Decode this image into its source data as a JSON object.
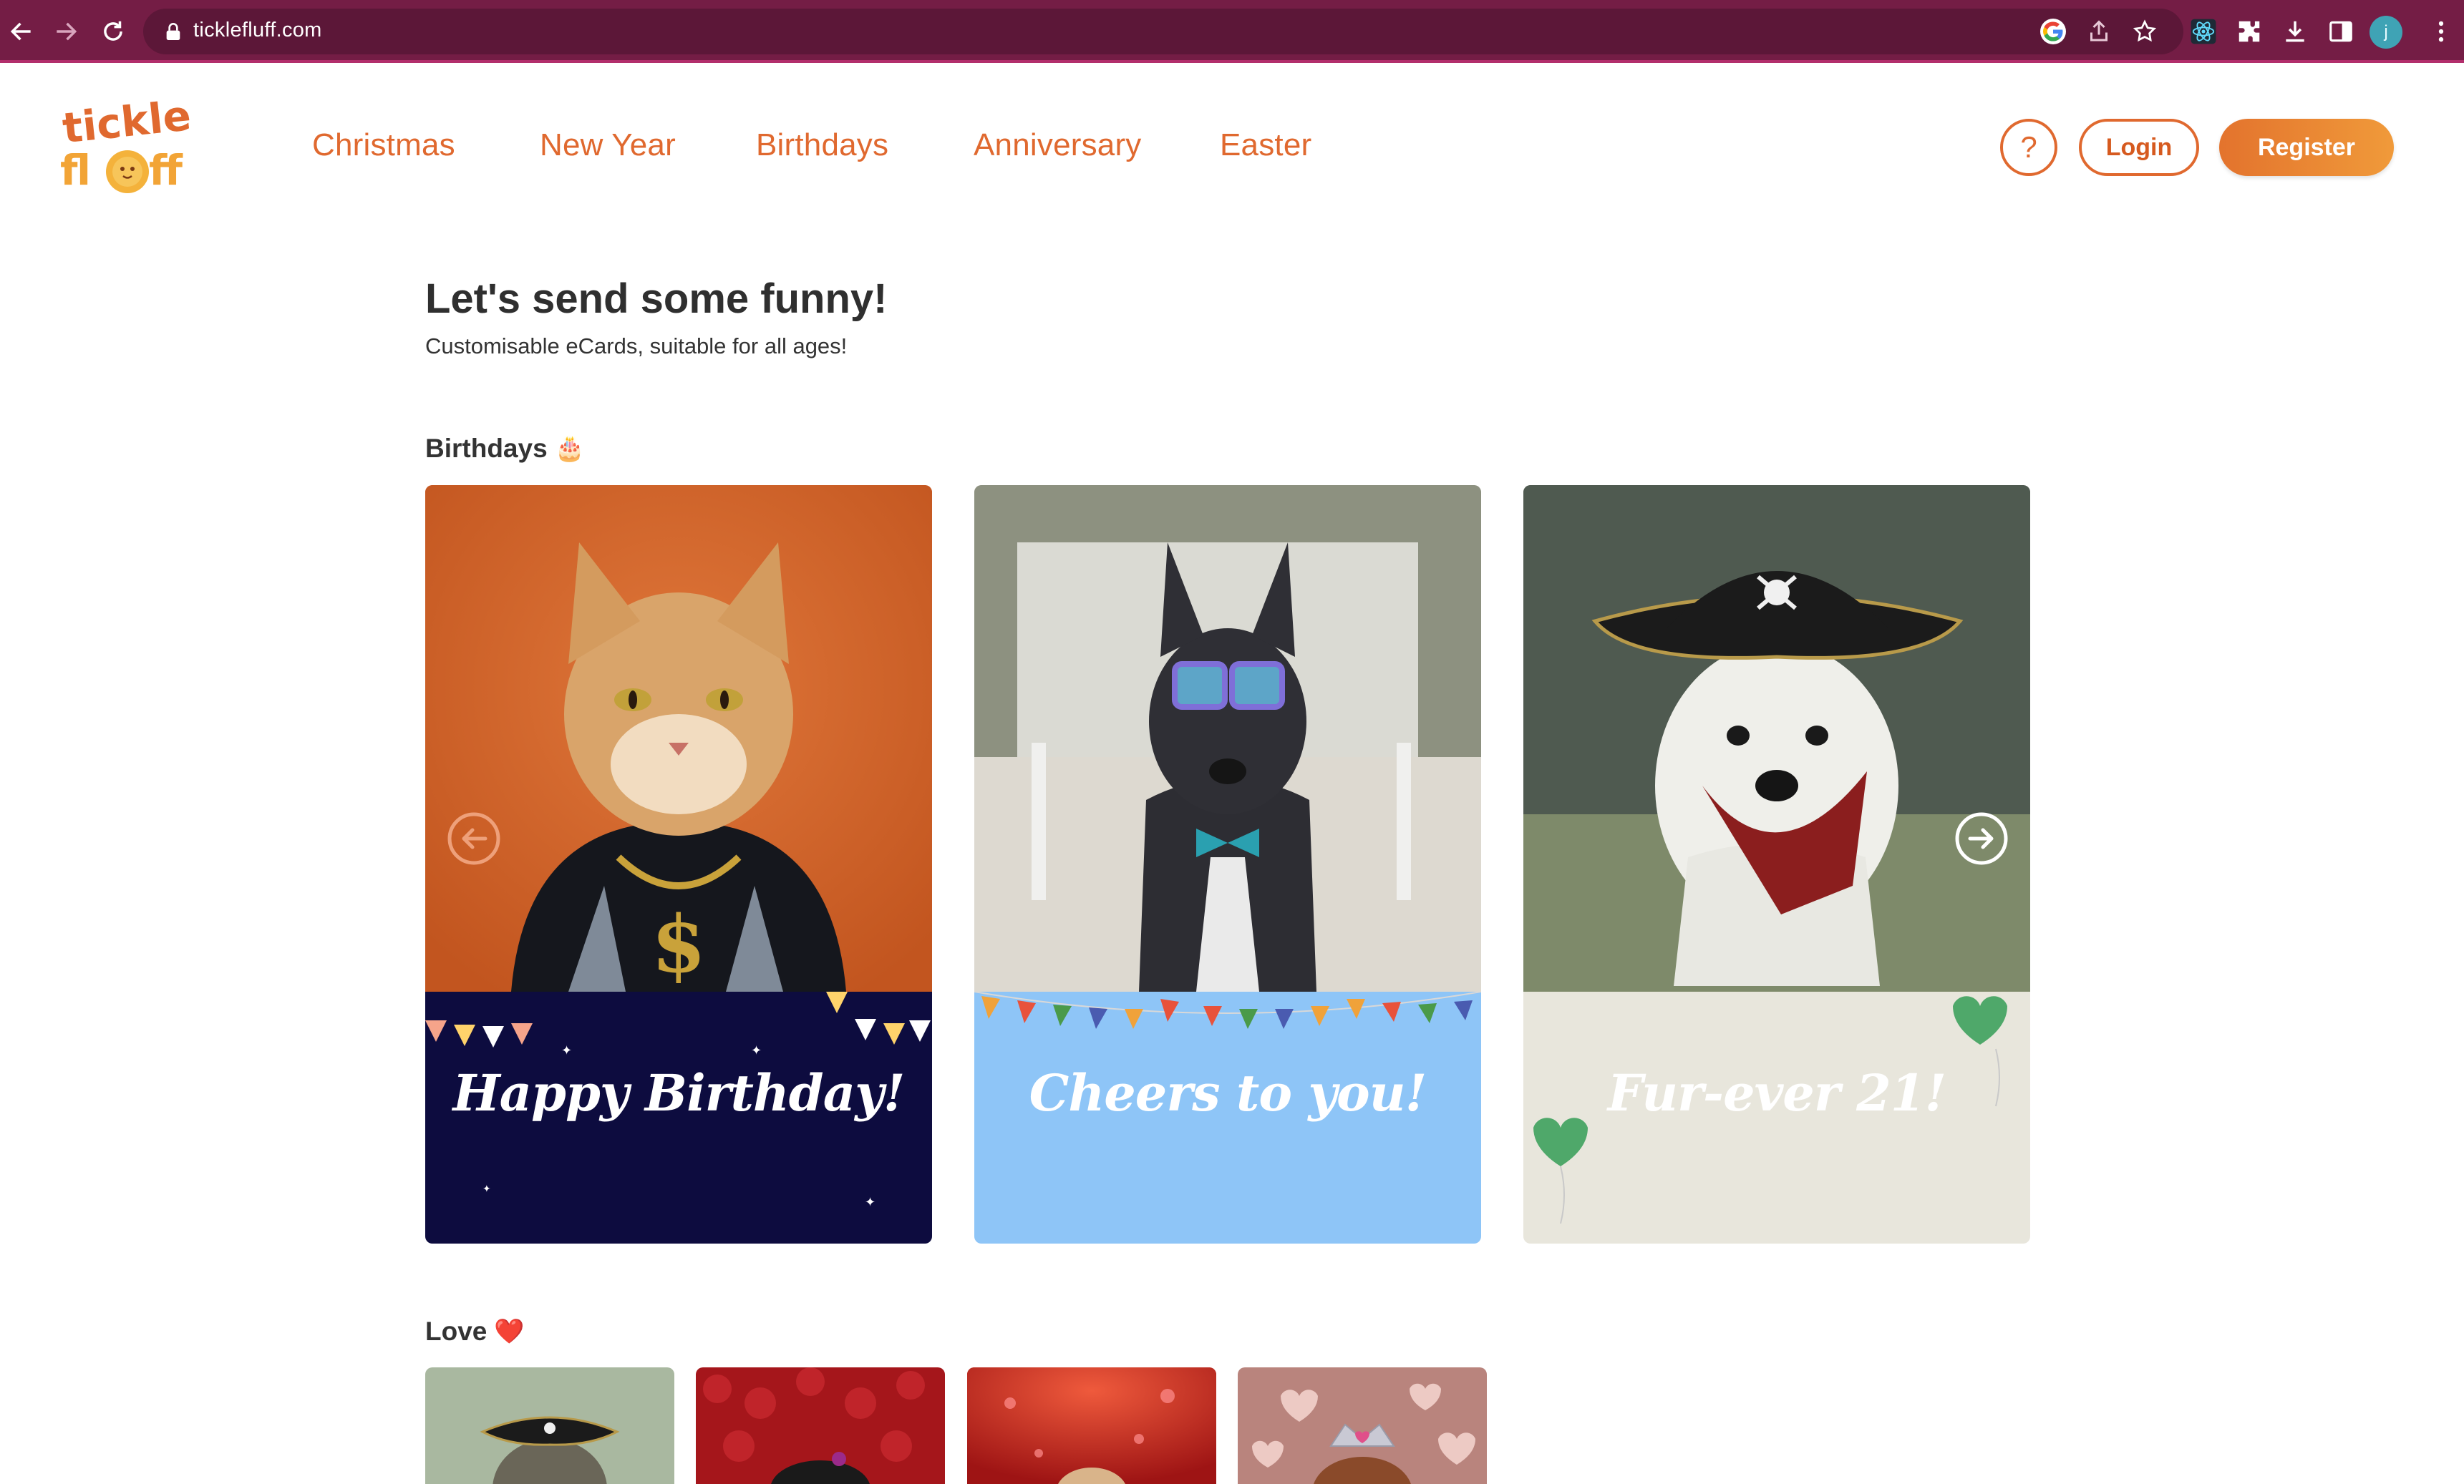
{
  "browser": {
    "url": "ticklefluff.com",
    "profile_initial": "j",
    "icons": [
      "back-arrow-icon",
      "forward-arrow-icon",
      "reload-icon",
      "lock-icon",
      "google-icon",
      "share-icon",
      "star-icon",
      "react-devtools-icon",
      "extensions-icon",
      "download-icon",
      "sidepanel-icon"
    ]
  },
  "header": {
    "logo_line1": "tickle",
    "logo_line2": "fluff",
    "nav": [
      "Christmas",
      "New Year",
      "Birthdays",
      "Anniversary",
      "Easter"
    ],
    "help_label": "?",
    "login_label": "Login",
    "register_label": "Register"
  },
  "hero": {
    "title": "Let's send some funny!",
    "subtitle": "Customisable eCards, suitable for all ages!"
  },
  "sections": {
    "birthdays": {
      "title": "Birthdays",
      "emoji": "🎂",
      "cards": [
        {
          "caption": "Happy Birthday!",
          "photo": "cat with gold chain",
          "banner_color": "#0d0c3f"
        },
        {
          "caption": "Cheers to you!",
          "photo": "dog with sunglasses and bow tie",
          "banner_color": "#8ec5f7"
        },
        {
          "caption": "Fur-ever 21!",
          "photo": "dog in pirate hat",
          "banner_color": "#e8e6dc"
        }
      ],
      "prev_arrow": "arrow-left-icon",
      "next_arrow": "arrow-right-icon"
    },
    "love": {
      "title": "Love",
      "emoji": "❤️",
      "thumbs": [
        "pirate cat",
        "dog on roses",
        "dog with hearts",
        "dog with tiara"
      ]
    }
  },
  "colors": {
    "brand_orange": "#e0692f",
    "browser_bar": "#741d45"
  }
}
